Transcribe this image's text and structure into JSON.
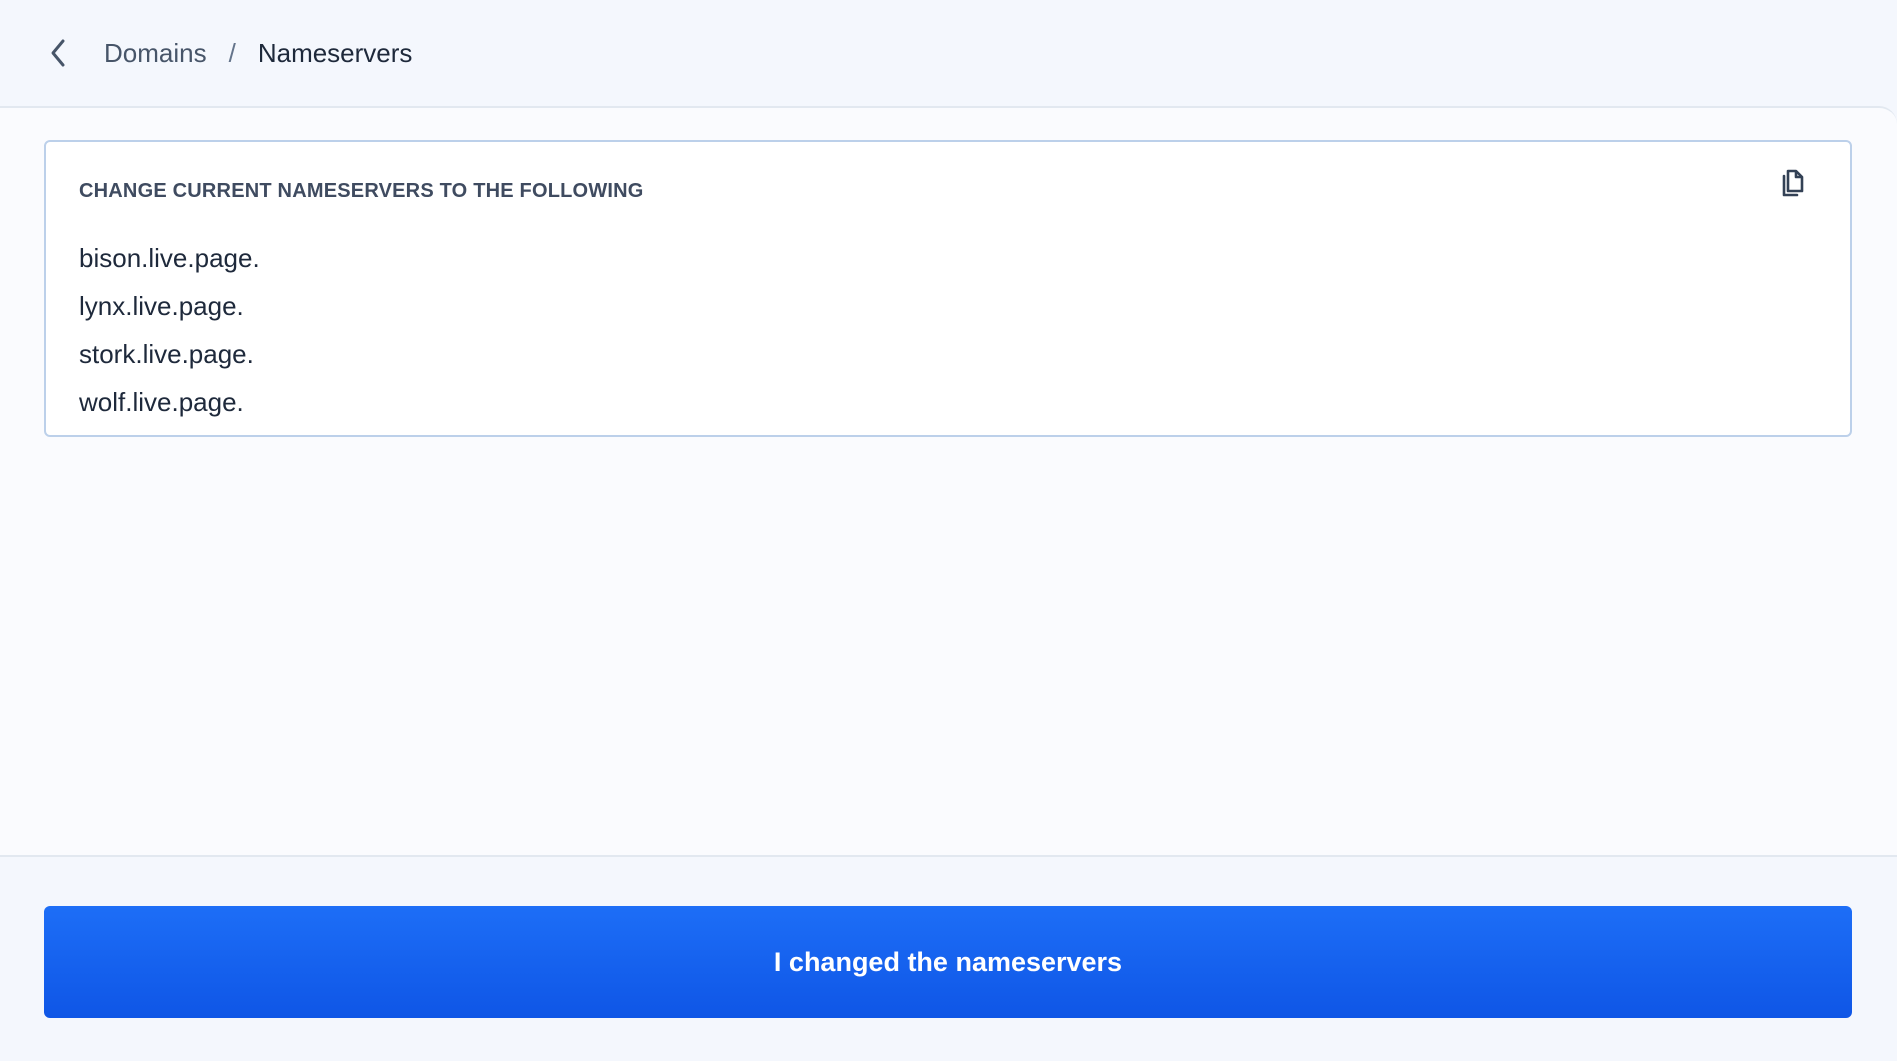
{
  "header": {
    "back_icon": "chevron-left-icon",
    "breadcrumb": {
      "parent": "Domains",
      "separator": "/",
      "current": "Nameservers"
    }
  },
  "nameservers_card": {
    "title": "CHANGE CURRENT NAMESERVERS TO THE FOLLOWING",
    "copy_icon": "copy-icon",
    "items": [
      "bison.live.page.",
      "lynx.live.page.",
      "stork.live.page.",
      "wolf.live.page."
    ]
  },
  "footer": {
    "confirm_label": "I changed the nameservers"
  },
  "colors": {
    "primary_button": "#1463f3",
    "card_border": "#bcd0ea",
    "page_background": "#f4f7fd"
  }
}
